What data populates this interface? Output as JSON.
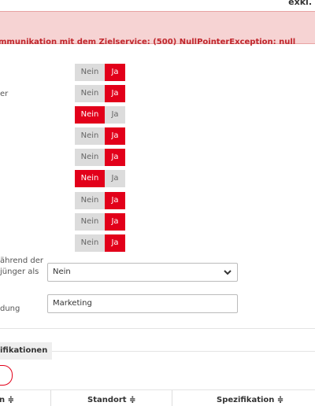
{
  "header": {
    "price_note": "exkl."
  },
  "alert": {
    "message": "mmunikation mit dem Zielservice: (500) NullPointerException: null"
  },
  "toggle_labels": {
    "no": "Nein",
    "yes": "Ja"
  },
  "rows": [
    {
      "label": "",
      "selected": "Ja"
    },
    {
      "label": "",
      "selected": "Ja"
    },
    {
      "label": "er",
      "selected": "Ja"
    },
    {
      "label": "",
      "selected": "Nein"
    },
    {
      "label": "",
      "selected": "Ja"
    },
    {
      "label": "",
      "selected": "Ja"
    },
    {
      "label": "",
      "selected": "Nein"
    },
    {
      "label": "",
      "selected": "Ja"
    },
    {
      "label": "",
      "selected": "Ja"
    },
    {
      "label": "",
      "selected": "Ja"
    }
  ],
  "select_field": {
    "label_line1": "ährend der",
    "label_line2": "jünger als",
    "value": "Nein"
  },
  "text_field": {
    "label": "dung",
    "value": "Marketing"
  },
  "section": {
    "title": "ifikationen"
  },
  "table": {
    "columns": [
      "n ≑",
      "Standort ≑",
      "Spezifikation ≑"
    ]
  },
  "colors": {
    "accent": "#e2001a",
    "alert_bg": "#f6d3d3",
    "alert_text": "#c0262c"
  }
}
